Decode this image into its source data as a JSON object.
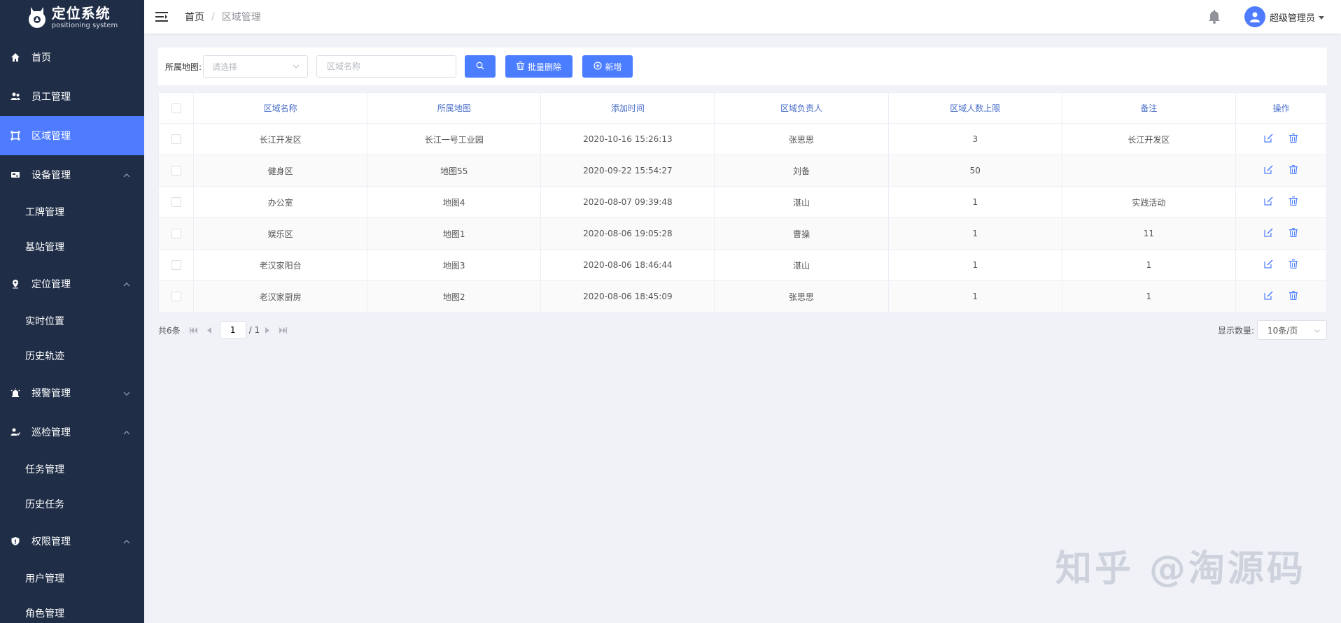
{
  "app": {
    "title": "定位系统",
    "subtitle": "positioning system"
  },
  "sidebar": {
    "items": [
      {
        "label": "首页",
        "icon": "home-icon"
      },
      {
        "label": "员工管理",
        "icon": "users-icon"
      },
      {
        "label": "区域管理",
        "icon": "area-icon",
        "active": true
      },
      {
        "label": "设备管理",
        "icon": "device-icon",
        "sub": [
          "工牌管理",
          "基站管理"
        ]
      },
      {
        "label": "定位管理",
        "icon": "location-icon",
        "sub": [
          "实时位置",
          "历史轨迹"
        ]
      },
      {
        "label": "报警管理",
        "icon": "alarm-icon"
      },
      {
        "label": "巡检管理",
        "icon": "patrol-icon",
        "sub": [
          "任务管理",
          "历史任务"
        ]
      },
      {
        "label": "权限管理",
        "icon": "shield-icon",
        "sub": [
          "用户管理",
          "角色管理"
        ]
      }
    ]
  },
  "header": {
    "breadcrumb_home": "首页",
    "breadcrumb_sep": "/",
    "breadcrumb_current": "区域管理",
    "user": "超级管理员"
  },
  "toolbar": {
    "map_label": "所属地图:",
    "map_placeholder": "请选择",
    "name_placeholder": "区域名称",
    "delete_label": "批量删除",
    "add_label": "新增"
  },
  "table": {
    "columns": [
      "区域名称",
      "所属地图",
      "添加时间",
      "区域负责人",
      "区域人数上限",
      "备注",
      "操作"
    ],
    "rows": [
      [
        "长江开发区",
        "长江一号工业园",
        "2020-10-16 15:26:13",
        "张思思",
        "3",
        "长江开发区"
      ],
      [
        "健身区",
        "地图55",
        "2020-09-22 15:54:27",
        "刘备",
        "50",
        ""
      ],
      [
        "办公室",
        "地图4",
        "2020-08-07 09:39:48",
        "湛山",
        "1",
        "实践活动"
      ],
      [
        "娱乐区",
        "地图1",
        "2020-08-06 19:05:28",
        "曹操",
        "1",
        "11"
      ],
      [
        "老汉家阳台",
        "地图3",
        "2020-08-06 18:46:44",
        "湛山",
        "1",
        "1"
      ],
      [
        "老汉家厨房",
        "地图2",
        "2020-08-06 18:45:09",
        "张思思",
        "1",
        "1"
      ]
    ]
  },
  "pager": {
    "total": "共6条",
    "page": "1",
    "pages": "/ 1",
    "size_label": "显示数量:",
    "size_value": "10条/页"
  },
  "watermark": "知乎 @淘源码",
  "colors": {
    "sidebar_bg": "#1f2d47",
    "accent": "#4f7cff",
    "button": "#4a7dff",
    "header_text": "#4a6fc9"
  }
}
